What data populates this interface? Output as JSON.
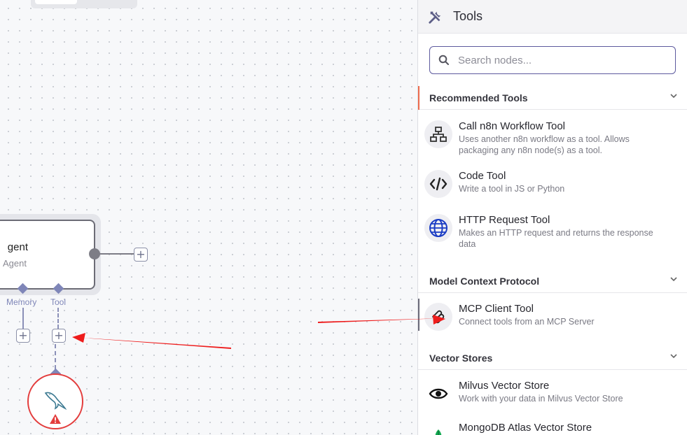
{
  "canvas": {
    "agent_node": {
      "title": "gent",
      "subtitle": "Agent"
    },
    "connectors": {
      "memory_label": "Memory",
      "tool_label": "Tool"
    },
    "add_symbol": "+",
    "warning_symbol": "!"
  },
  "panel": {
    "title": "Tools",
    "search": {
      "placeholder": "Search nodes...",
      "value": ""
    },
    "sections": [
      {
        "label": "Recommended Tools",
        "items": [
          {
            "name": "Call n8n Workflow Tool",
            "desc": "Uses another n8n workflow as a tool. Allows packaging any n8n node(s) as a tool.",
            "icon": "sitemap-icon"
          },
          {
            "name": "Code Tool",
            "desc": "Write a tool in JS or Python",
            "icon": "code-icon"
          },
          {
            "name": "HTTP Request Tool",
            "desc": "Makes an HTTP request and returns the response data",
            "icon": "globe-icon"
          }
        ]
      },
      {
        "label": "Model Context Protocol",
        "items": [
          {
            "name": "MCP Client Tool",
            "desc": "Connect tools from an MCP Server",
            "icon": "mcp-icon"
          }
        ]
      },
      {
        "label": "Vector Stores",
        "items": [
          {
            "name": "Milvus Vector Store",
            "desc": "Work with your data in Milvus Vector Store",
            "icon": "eye-icon"
          },
          {
            "name": "MongoDB Atlas Vector Store",
            "desc": "",
            "icon": "leaf-icon"
          }
        ]
      }
    ]
  },
  "colors": {
    "accent": "#ee6b4d",
    "search_border": "#5d5a9e",
    "connector": "#7f86b8",
    "error": "#e33c3c",
    "annotation_arrow": "#ee1c1c"
  }
}
